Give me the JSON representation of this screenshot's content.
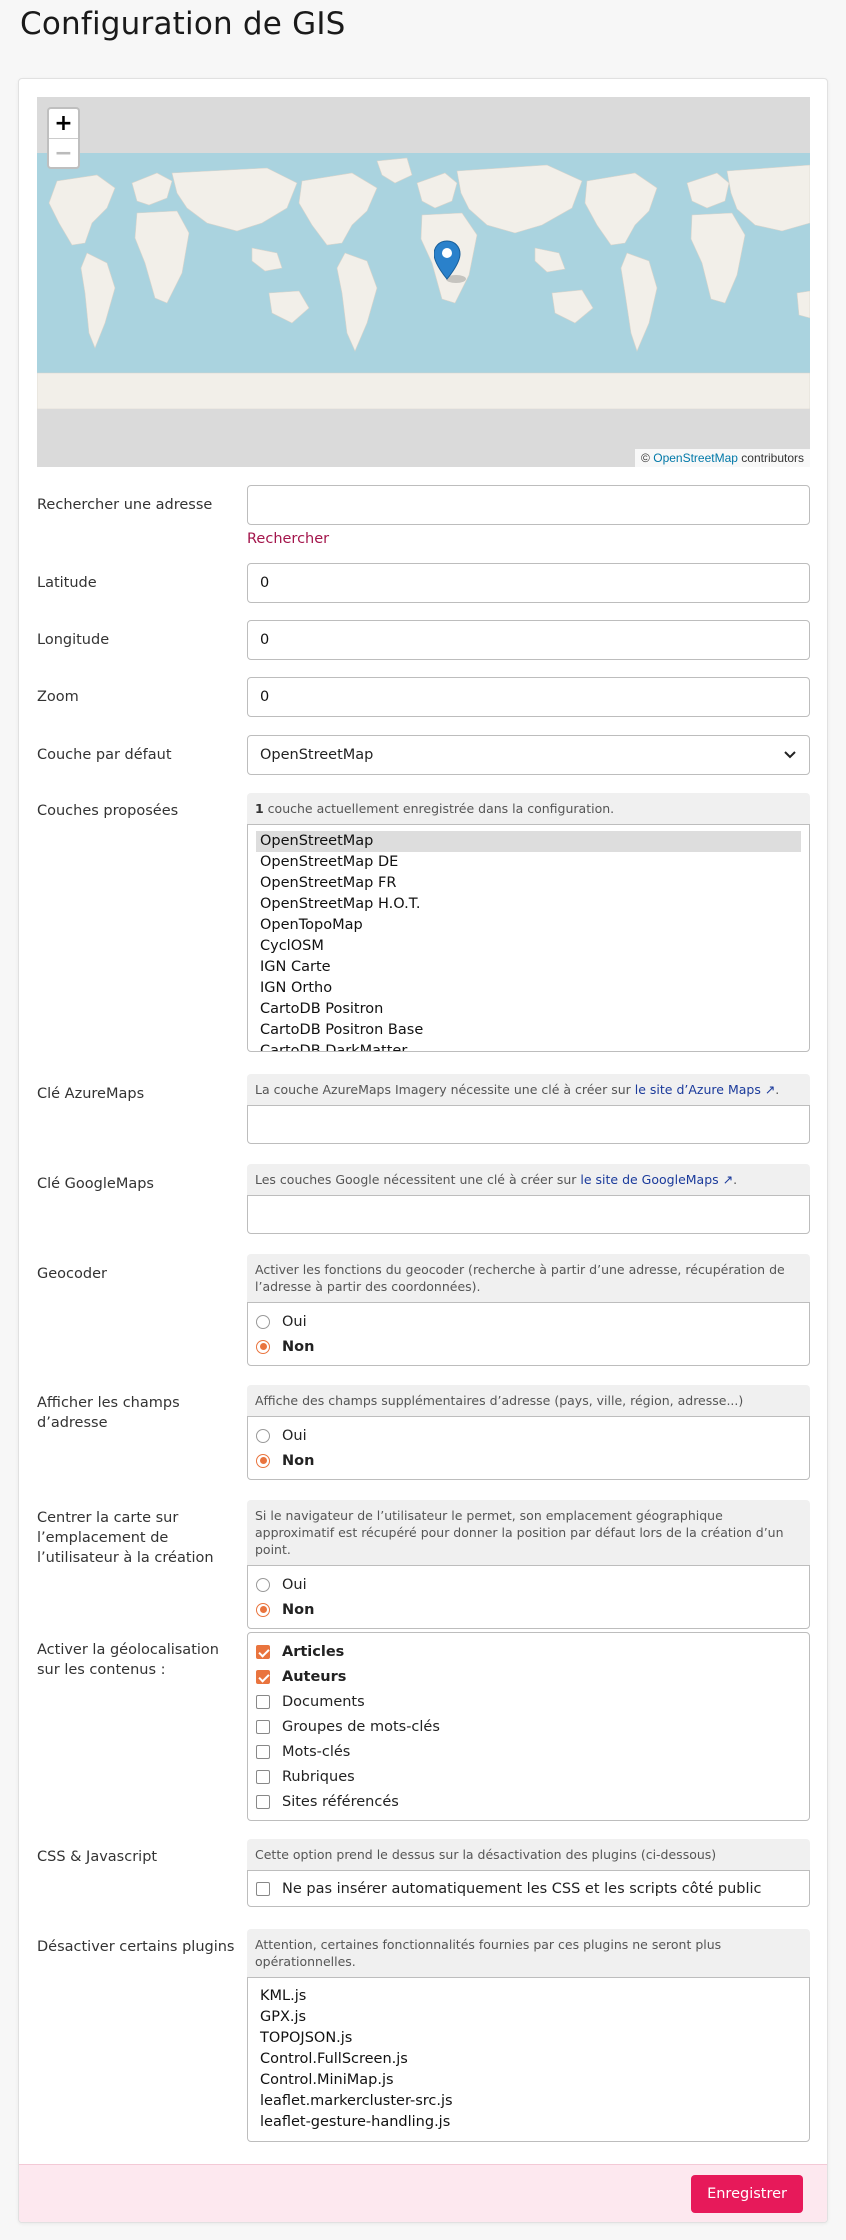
{
  "page": {
    "title": "Configuration de GIS"
  },
  "map": {
    "zoom_in": "+",
    "zoom_out": "−",
    "attribution_prefix": "©",
    "attribution_link": "OpenStreetMap",
    "attribution_suffix": "contributors"
  },
  "form": {
    "search": {
      "label": "Rechercher une adresse",
      "value": "",
      "link": "Rechercher"
    },
    "latitude": {
      "label": "Latitude",
      "value": "0"
    },
    "longitude": {
      "label": "Longitude",
      "value": "0"
    },
    "zoom": {
      "label": "Zoom",
      "value": "0"
    },
    "default_layer": {
      "label": "Couche par défaut",
      "value": "OpenStreetMap"
    },
    "layers": {
      "label": "Couches proposées",
      "note_count": "1",
      "note_text": " couche actuellement enregistrée dans la configuration.",
      "options": [
        "OpenStreetMap",
        "OpenStreetMap DE",
        "OpenStreetMap FR",
        "OpenStreetMap H.O.T.",
        "OpenTopoMap",
        "CyclOSM",
        "IGN Carte",
        "IGN Ortho",
        "CartoDB Positron",
        "CartoDB Positron Base",
        "CartoDB DarkMatter"
      ]
    },
    "azure": {
      "label": "Clé AzureMaps",
      "note_text": "La couche AzureMaps Imagery nécessite une clé à créer sur ",
      "note_link": "le site d’Azure Maps ↗",
      "note_end": "."
    },
    "google": {
      "label": "Clé GoogleMaps",
      "note_text": "Les couches Google nécessitent une clé à créer sur ",
      "note_link": "le site de GoogleMaps ↗",
      "note_end": "."
    },
    "geocoder": {
      "label": "Geocoder",
      "note": "Activer les fonctions du geocoder (recherche à partir d’une adresse, récupération de l’adresse à partir des coordonnées).",
      "yes": "Oui",
      "no": "Non"
    },
    "address_fields": {
      "label": "Afficher les champs d’adresse",
      "note": "Affiche des champs supplémentaires d’adresse (pays, ville, région, adresse...)",
      "yes": "Oui",
      "no": "Non"
    },
    "center_user": {
      "label": "Centrer la carte sur l’emplacement de l’utilisateur à la création",
      "note": "Si le navigateur de l’utilisateur le permet, son emplacement géographique approximatif est récupéré pour donner la position par défaut lors de la création d’un point.",
      "yes": "Oui",
      "no": "Non"
    },
    "geoloc": {
      "label": "Activer la géolocalisation sur les contenus :",
      "items": [
        {
          "label": "Articles",
          "checked": true
        },
        {
          "label": "Auteurs",
          "checked": true
        },
        {
          "label": "Documents",
          "checked": false
        },
        {
          "label": "Groupes de mots-clés",
          "checked": false
        },
        {
          "label": "Mots-clés",
          "checked": false
        },
        {
          "label": "Rubriques",
          "checked": false
        },
        {
          "label": "Sites référencés",
          "checked": false
        }
      ]
    },
    "css_js": {
      "label": "CSS & Javascript",
      "note": "Cette option prend le dessus sur la désactivation des plugins (ci-dessous)",
      "checkbox": "Ne pas insérer automatiquement les CSS et les scripts côté public"
    },
    "plugins": {
      "label": "Désactiver certains plugins",
      "note": "Attention, certaines fonctionnalités fournies par ces plugins ne seront plus opérationnelles.",
      "options": [
        "KML.js",
        "GPX.js",
        "TOPOJSON.js",
        "Control.FullScreen.js",
        "Control.MiniMap.js",
        "leaflet.markercluster-src.js",
        "leaflet-gesture-handling.js"
      ]
    }
  },
  "footer": {
    "save": "Enregistrer"
  },
  "colors": {
    "accent": "#e9743e",
    "save": "#e7195a",
    "link": "#a3154b",
    "ocean": "#aad3df",
    "land": "#f2efe9"
  }
}
